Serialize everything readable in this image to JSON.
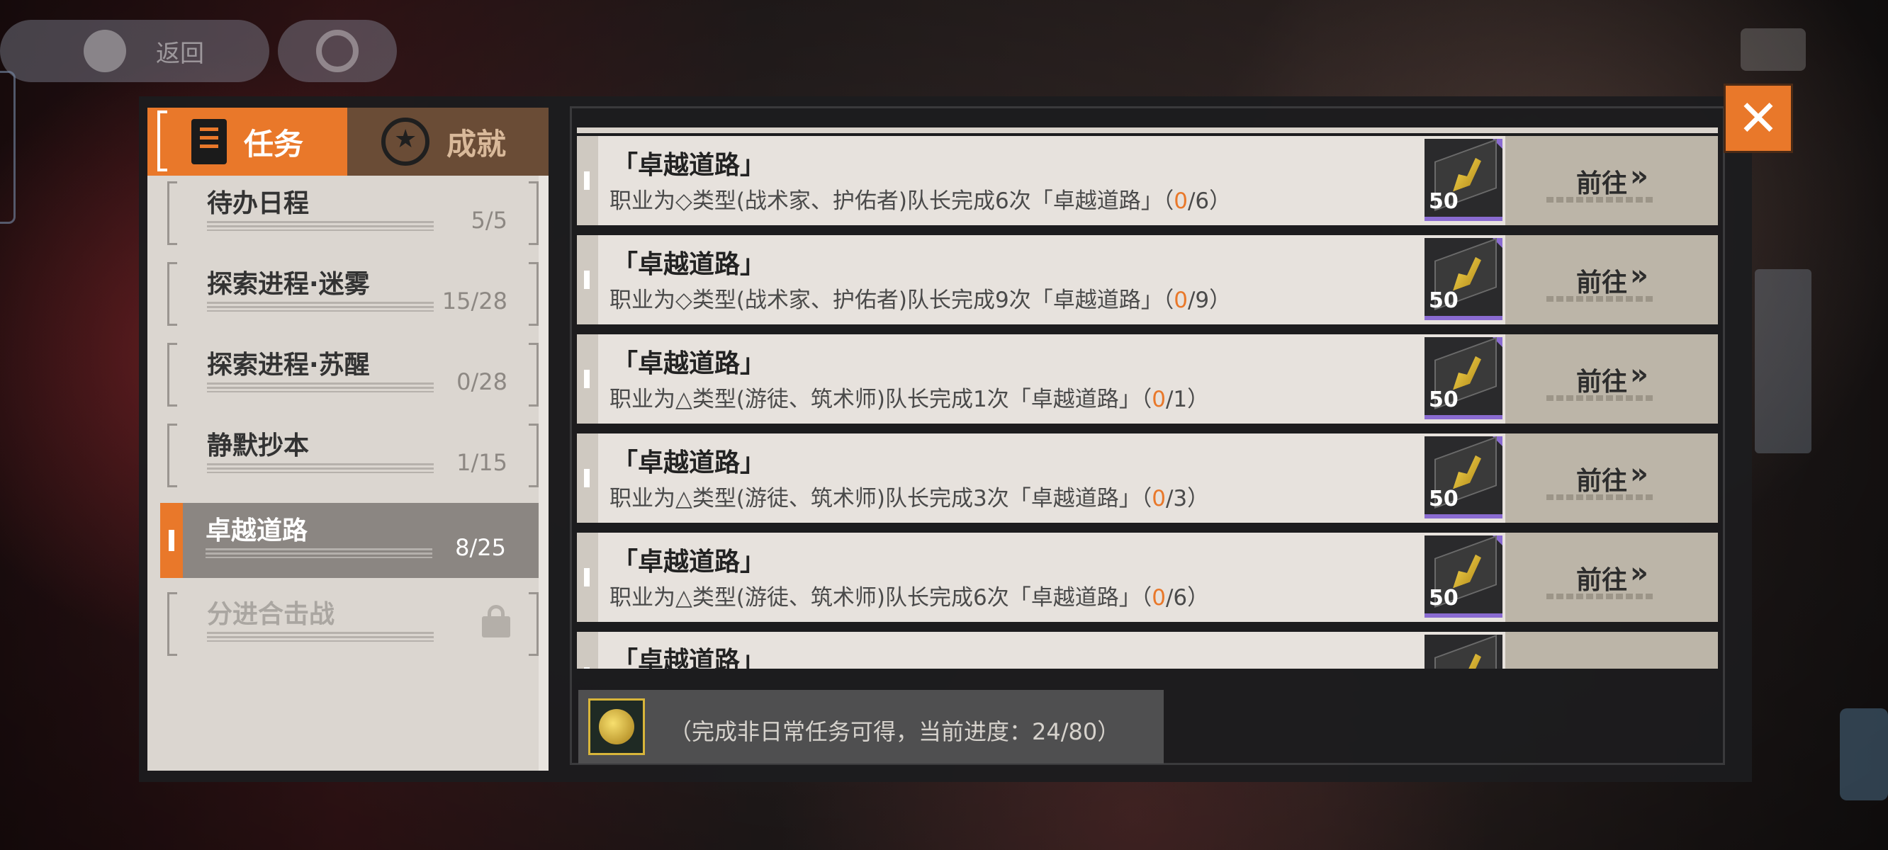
{
  "top_bar": {
    "back_label": "返回"
  },
  "tabs": [
    {
      "label": "任务",
      "active": true
    },
    {
      "label": "成就",
      "active": false
    }
  ],
  "categories": [
    {
      "name": "待办日程",
      "progress": "5/5",
      "active": false,
      "locked": false
    },
    {
      "name": "探索进程·迷雾",
      "progress": "15/28",
      "active": false,
      "locked": false
    },
    {
      "name": "探索进程·苏醒",
      "progress": "0/28",
      "active": false,
      "locked": false
    },
    {
      "name": "静默抄本",
      "progress": "1/15",
      "active": false,
      "locked": false
    },
    {
      "name": "卓越道路",
      "progress": "8/25",
      "active": true,
      "locked": false
    },
    {
      "name": "分进合击战",
      "progress": "",
      "active": false,
      "locked": true
    }
  ],
  "tasks": [
    {
      "title": "「卓越道路」",
      "desc_prefix": "职业为◇类型(战术家、护佑者)队长完成6次「卓越道路」（",
      "current": "0",
      "total": "/6）",
      "reward_count": "50",
      "go_label": "前往"
    },
    {
      "title": "「卓越道路」",
      "desc_prefix": "职业为◇类型(战术家、护佑者)队长完成9次「卓越道路」（",
      "current": "0",
      "total": "/9）",
      "reward_count": "50",
      "go_label": "前往"
    },
    {
      "title": "「卓越道路」",
      "desc_prefix": "职业为△类型(游徒、筑术师)队长完成1次「卓越道路」（",
      "current": "0",
      "total": "/1）",
      "reward_count": "50",
      "go_label": "前往"
    },
    {
      "title": "「卓越道路」",
      "desc_prefix": "职业为△类型(游徒、筑术师)队长完成3次「卓越道路」（",
      "current": "0",
      "total": "/3）",
      "reward_count": "50",
      "go_label": "前往"
    },
    {
      "title": "「卓越道路」",
      "desc_prefix": "职业为△类型(游徒、筑术师)队长完成6次「卓越道路」（",
      "current": "0",
      "total": "/6）",
      "reward_count": "50",
      "go_label": "前往"
    },
    {
      "title": "「卓越道路」",
      "desc_prefix": "",
      "current": "",
      "total": "",
      "reward_count": "",
      "go_label": ""
    }
  ],
  "bottom": {
    "text": "（完成非日常任务可得，当前进度：24/80）"
  },
  "colors": {
    "accent": "#e9782a",
    "panel": "#1c1c1e",
    "row_bg": "#e7e2dd",
    "go_bg": "#bcb5a8",
    "reward_rarity": "#8a6bd1"
  },
  "icons": {
    "task_tab": "clipboard-check-icon",
    "achievement_tab": "star-medal-icon",
    "go": "double-chevron-right-icon",
    "close": "close-icon",
    "lock": "lock-icon",
    "reward": "gold-ticket-icon",
    "bottom_medal": "gold-medal-icon"
  }
}
